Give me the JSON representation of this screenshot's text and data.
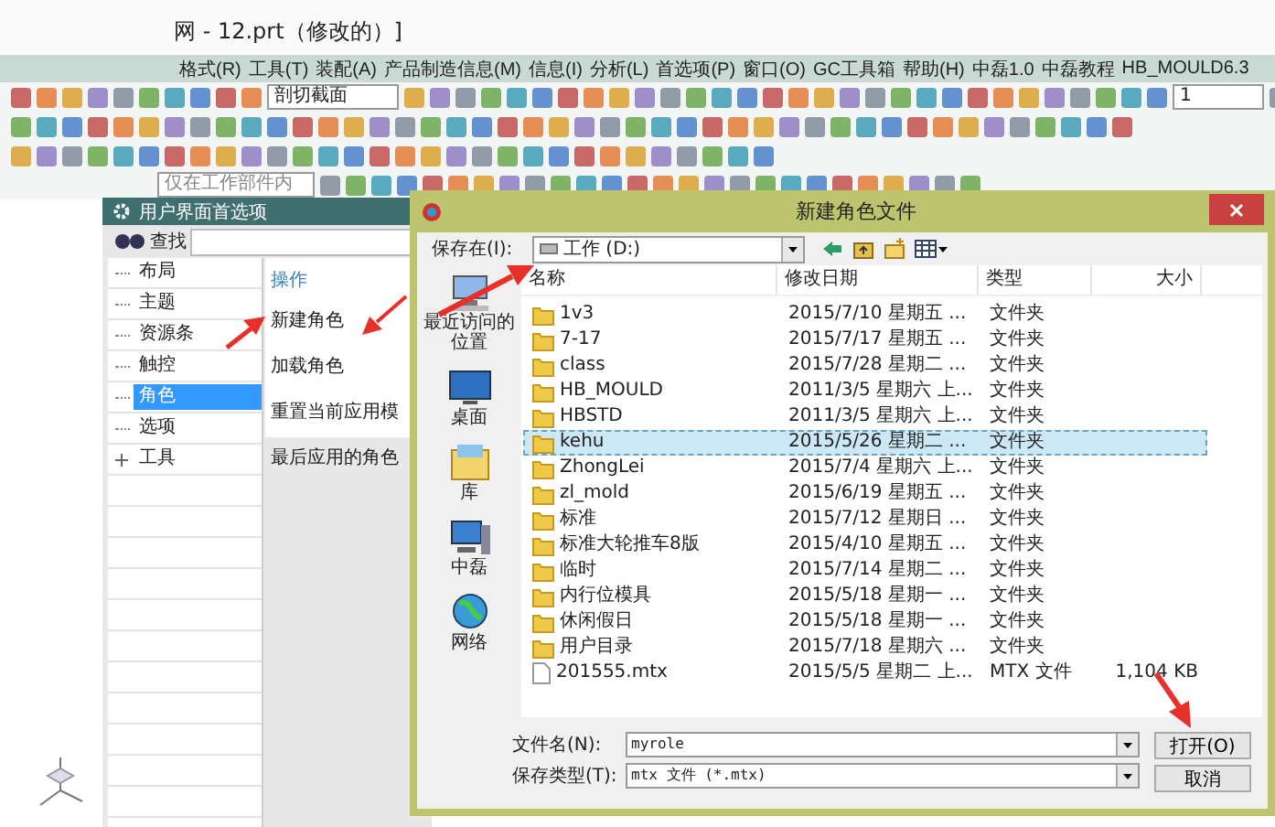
{
  "window": {
    "title": "网 - 12.prt（修改的）]"
  },
  "menu": [
    "格式(R)",
    "工具(T)",
    "装配(A)",
    "产品制造信息(M)",
    "信息(I)",
    "分析(L)",
    "首选项(P)",
    "窗口(O)",
    "GC工具箱",
    "帮助(H)",
    "中磊1.0",
    "中磊教程",
    "HB_MOULD6.3"
  ],
  "toolbar": {
    "section_field": "剖切截面",
    "layer_select": "1",
    "filter_select": "仅在工作部件内"
  },
  "preferences_dialog": {
    "title": "用户界面首选项",
    "search_label": "查找",
    "tree": [
      {
        "label": "布局",
        "selected": false,
        "kind": "leaf"
      },
      {
        "label": "主题",
        "selected": false,
        "kind": "leaf"
      },
      {
        "label": "资源条",
        "selected": false,
        "kind": "leaf"
      },
      {
        "label": "触控",
        "selected": false,
        "kind": "leaf"
      },
      {
        "label": "角色",
        "selected": true,
        "kind": "leaf"
      },
      {
        "label": "选项",
        "selected": false,
        "kind": "leaf"
      },
      {
        "label": "工具",
        "selected": false,
        "kind": "collapsed"
      }
    ],
    "actions_heading": "操作",
    "actions": [
      "新建角色",
      "加载角色",
      "重置当前应用模",
      "最后应用的角色"
    ]
  },
  "file_dialog": {
    "title": "新建角色文件",
    "save_in_label": "保存在(I):",
    "save_in": "工作 (D:)",
    "places": [
      {
        "label": "最近访问的位置",
        "kind": "recent"
      },
      {
        "label": "桌面",
        "kind": "desktop"
      },
      {
        "label": "库",
        "kind": "library"
      },
      {
        "label": "中磊",
        "kind": "computer"
      },
      {
        "label": "网络",
        "kind": "network"
      }
    ],
    "columns": [
      "名称",
      "修改日期",
      "类型",
      "大小"
    ],
    "rows": [
      {
        "name": "1v3",
        "date": "2015/7/10 星期五 ...",
        "type": "文件夹",
        "kind": "folder",
        "selected": false
      },
      {
        "name": "7-17",
        "date": "2015/7/17 星期五 ...",
        "type": "文件夹",
        "kind": "folder",
        "selected": false
      },
      {
        "name": "class",
        "date": "2015/7/28 星期二 ...",
        "type": "文件夹",
        "kind": "folder",
        "selected": false
      },
      {
        "name": "HB_MOULD",
        "date": "2011/3/5 星期六 上...",
        "type": "文件夹",
        "kind": "folder",
        "selected": false
      },
      {
        "name": "HBSTD",
        "date": "2011/3/5 星期六 上...",
        "type": "文件夹",
        "kind": "folder",
        "selected": false
      },
      {
        "name": "kehu",
        "date": "2015/5/26 星期二 ...",
        "type": "文件夹",
        "kind": "folder",
        "selected": true
      },
      {
        "name": "ZhongLei",
        "date": "2015/7/4 星期六 上...",
        "type": "文件夹",
        "kind": "folder",
        "selected": false
      },
      {
        "name": "zl_mold",
        "date": "2015/6/19 星期五 ...",
        "type": "文件夹",
        "kind": "folder",
        "selected": false
      },
      {
        "name": "标准",
        "date": "2015/7/12 星期日 ...",
        "type": "文件夹",
        "kind": "folder",
        "selected": false
      },
      {
        "name": "标准大轮推车8版",
        "date": "2015/4/10 星期五 ...",
        "type": "文件夹",
        "kind": "folder",
        "selected": false
      },
      {
        "name": "临时",
        "date": "2015/7/14 星期二 ...",
        "type": "文件夹",
        "kind": "folder",
        "selected": false
      },
      {
        "name": "内行位模具",
        "date": "2015/5/18 星期一 ...",
        "type": "文件夹",
        "kind": "folder",
        "selected": false
      },
      {
        "name": "休闲假日",
        "date": "2015/5/18 星期一 ...",
        "type": "文件夹",
        "kind": "folder",
        "selected": false
      },
      {
        "name": "用户目录",
        "date": "2015/7/18 星期六 ...",
        "type": "文件夹",
        "kind": "folder",
        "selected": false
      },
      {
        "name": "201555.mtx",
        "date": "2015/5/5 星期二 上...",
        "type": "MTX 文件",
        "size": "1,104 KB",
        "kind": "file",
        "selected": false
      }
    ],
    "filename_label": "文件名(N):",
    "filename": "myrole",
    "filetype_label": "保存类型(T):",
    "filetype": "mtx 文件 (*.mtx)",
    "open_button": "打开(O)",
    "cancel_button": "取消"
  }
}
